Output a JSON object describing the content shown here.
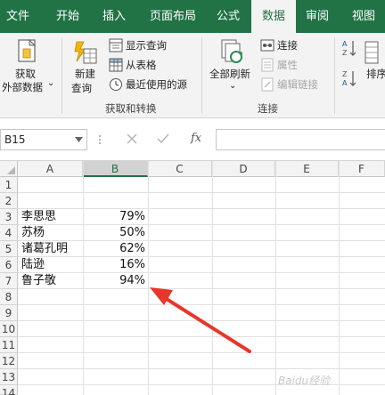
{
  "ribbon_tabs": [
    "文件",
    "开始",
    "插入",
    "页面布局",
    "公式",
    "数据",
    "审阅",
    "视图"
  ],
  "active_tab": "数据",
  "groups": {
    "get_external": {
      "label_line1": "获取",
      "label_line2": "外部数据",
      "dropdown": "⌄"
    },
    "get_transform": {
      "new_query_line1": "新建",
      "new_query_line2": "查询",
      "show_queries": "显示查询",
      "from_table": "从表格",
      "recent_sources": "最近使用的源",
      "group_label": "获取和转换"
    },
    "connections": {
      "refresh_all": "全部刷新",
      "refresh_dropdown": "⌄",
      "connections": "连接",
      "properties": "属性",
      "edit_links": "编辑链接",
      "group_label": "连接"
    },
    "sort": {
      "sort_label": "排序"
    }
  },
  "formula_bar": {
    "name_box": "B15",
    "fx": "fx",
    "formula": ""
  },
  "columns": [
    "A",
    "B",
    "C",
    "D",
    "E",
    "F"
  ],
  "selected_column": "B",
  "rows": [
    "1",
    "2",
    "3",
    "4",
    "5",
    "6",
    "7",
    "8",
    "9",
    "10",
    "11",
    "12",
    "13",
    "14"
  ],
  "data_rows": [
    {
      "row": "3",
      "name": "李思思",
      "pct": "79%"
    },
    {
      "row": "4",
      "name": "苏杨",
      "pct": "50%"
    },
    {
      "row": "5",
      "name": "诸葛孔明",
      "pct": "62%"
    },
    {
      "row": "6",
      "name": "陆逊",
      "pct": "16%"
    },
    {
      "row": "7",
      "name": "鲁子敬",
      "pct": "94%"
    }
  ],
  "watermark": "Baidu经验",
  "colors": {
    "brand": "#217346",
    "arrow": "#e8362a"
  }
}
